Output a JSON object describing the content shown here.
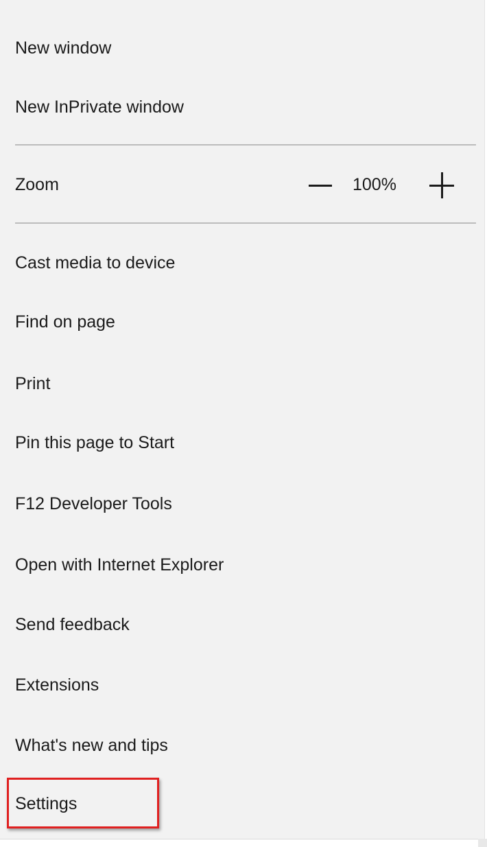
{
  "menu": {
    "top_items": [
      {
        "label": "New window"
      },
      {
        "label": "New InPrivate window"
      }
    ],
    "zoom": {
      "label": "Zoom",
      "value": "100%",
      "decrease_icon": "minus-icon",
      "increase_icon": "plus-icon"
    },
    "items": [
      {
        "label": "Cast media to device"
      },
      {
        "label": "Find on page"
      },
      {
        "label": "Print"
      },
      {
        "label": "Pin this page to Start"
      },
      {
        "label": "F12 Developer Tools"
      },
      {
        "label": "Open with Internet Explorer"
      },
      {
        "label": "Send feedback"
      },
      {
        "label": "Extensions"
      },
      {
        "label": "What's new and tips"
      },
      {
        "label": "Settings"
      }
    ],
    "highlight_color": "#e02020",
    "background_color": "#f2f2f2"
  }
}
